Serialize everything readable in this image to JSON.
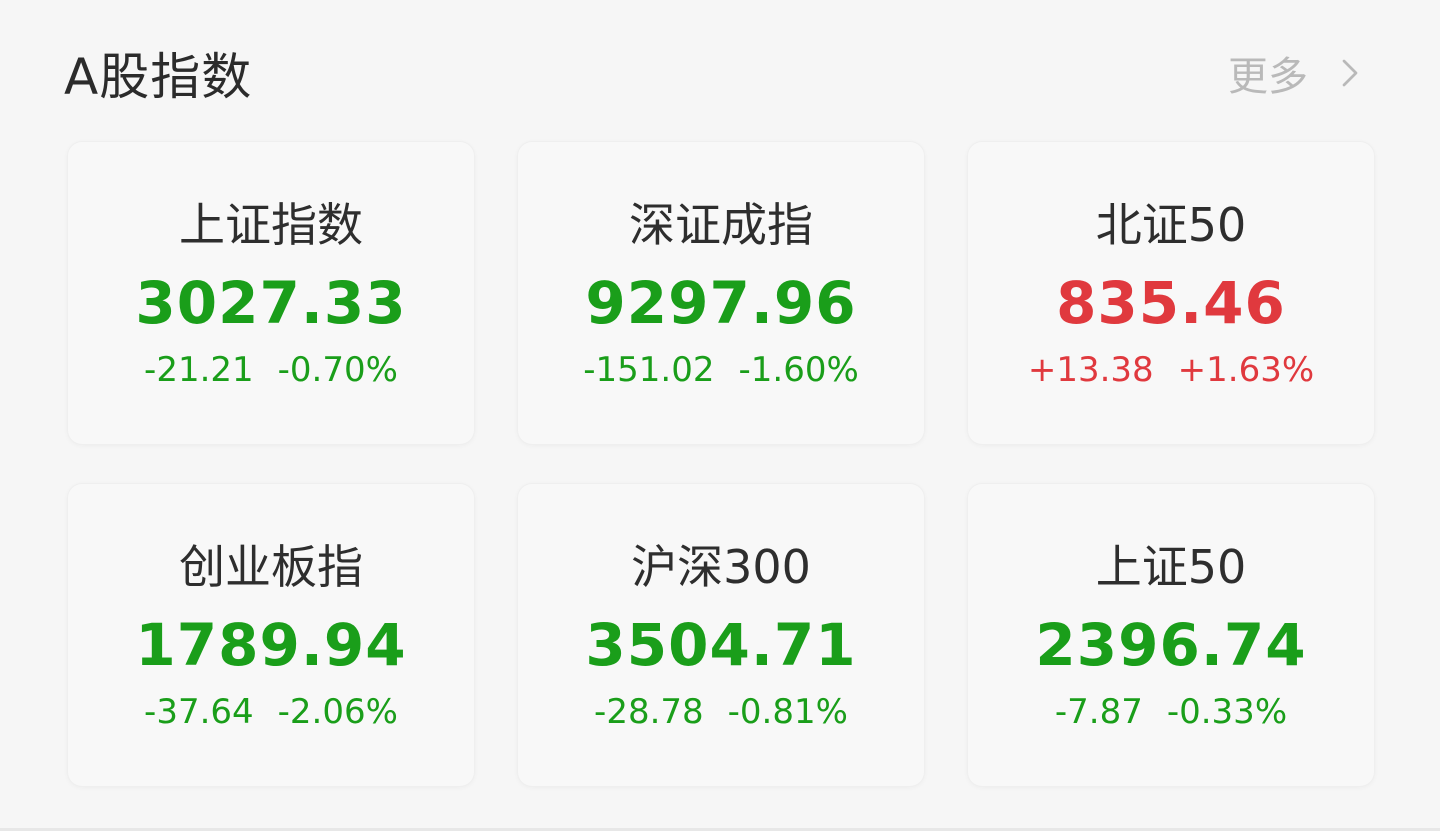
{
  "header": {
    "title": "A股指数",
    "more_label": "更多"
  },
  "colors": {
    "down": "#1a9e1a",
    "up": "#e0393e"
  },
  "indices": [
    {
      "name": "上证指数",
      "value": "3027.33",
      "change": "-21.21",
      "percent": "-0.70%",
      "direction": "down"
    },
    {
      "name": "深证成指",
      "value": "9297.96",
      "change": "-151.02",
      "percent": "-1.60%",
      "direction": "down"
    },
    {
      "name": "北证50",
      "value": "835.46",
      "change": "+13.38",
      "percent": "+1.63%",
      "direction": "up"
    },
    {
      "name": "创业板指",
      "value": "1789.94",
      "change": "-37.64",
      "percent": "-2.06%",
      "direction": "down"
    },
    {
      "name": "沪深300",
      "value": "3504.71",
      "change": "-28.78",
      "percent": "-0.81%",
      "direction": "down"
    },
    {
      "name": "上证50",
      "value": "2396.74",
      "change": "-7.87",
      "percent": "-0.33%",
      "direction": "down"
    }
  ]
}
